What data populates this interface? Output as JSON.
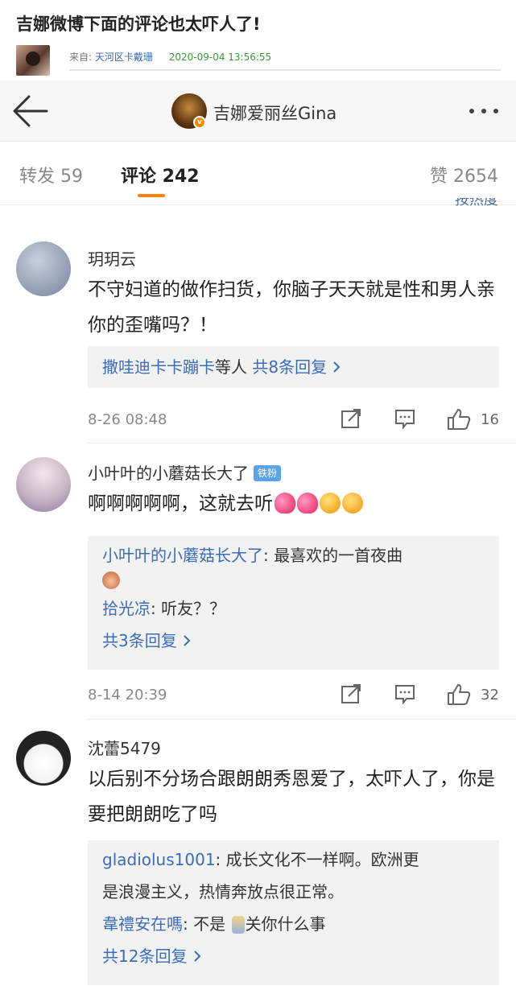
{
  "article": {
    "title": "吉娜微博下面的评论也太吓人了!",
    "meta_prefix": "来自:",
    "source": "天河区卡戴珊",
    "time": "2020-09-04 13:56:55"
  },
  "app_bar": {
    "title": "吉娜爱丽丝Gina"
  },
  "tabs": {
    "repost": "转发 59",
    "comment": "评论 242",
    "like": "赞 2654",
    "sort": "按热度"
  },
  "comments": [
    {
      "user": "玥玥云",
      "text": "不守妇道的做作扫货，你脑子天天就是性和男人亲你的歪嘴吗？！",
      "reply_summary_users": "撒哇迪卡卡蹦卡",
      "reply_summary_mid": "等人",
      "reply_summary_count": "共8条回复",
      "time": "8-26 08:48",
      "likes": "16"
    },
    {
      "user": "小叶叶的小蘑菇长大了",
      "badge": "铁粉",
      "text": "啊啊啊啊啊，这就去听",
      "replies": [
        {
          "user": "小叶叶的小蘑菇长大了",
          "text": ": 最喜欢的一首夜曲"
        },
        {
          "user": "拾光凉",
          "text": ": 听友？？"
        }
      ],
      "more": "共3条回复",
      "time": "8-14 20:39",
      "likes": "32"
    },
    {
      "user": "沈蕾5479",
      "text": "以后别不分场合跟朗朗秀恩爱了，太吓人了，你是要把朗朗吃了吗",
      "replies": [
        {
          "user": "gladiolus1001",
          "text": ": 成长文化不一样啊。欧洲更"
        },
        {
          "user": "",
          "text": "是浪漫主义，热情奔放点很正常。"
        },
        {
          "user": "韋禮安在嗎",
          "text": ": 不是 ",
          "text2": "关你什么事"
        }
      ],
      "more": "共12条回复"
    }
  ],
  "colors": {
    "accent": "#ff8200",
    "link": "#3b6cb8",
    "badge": "#5aa3e8"
  },
  "icons": [
    "back-arrow-icon",
    "more-icon",
    "share-icon",
    "comment-icon",
    "like-icon",
    "chevron-right-icon"
  ]
}
